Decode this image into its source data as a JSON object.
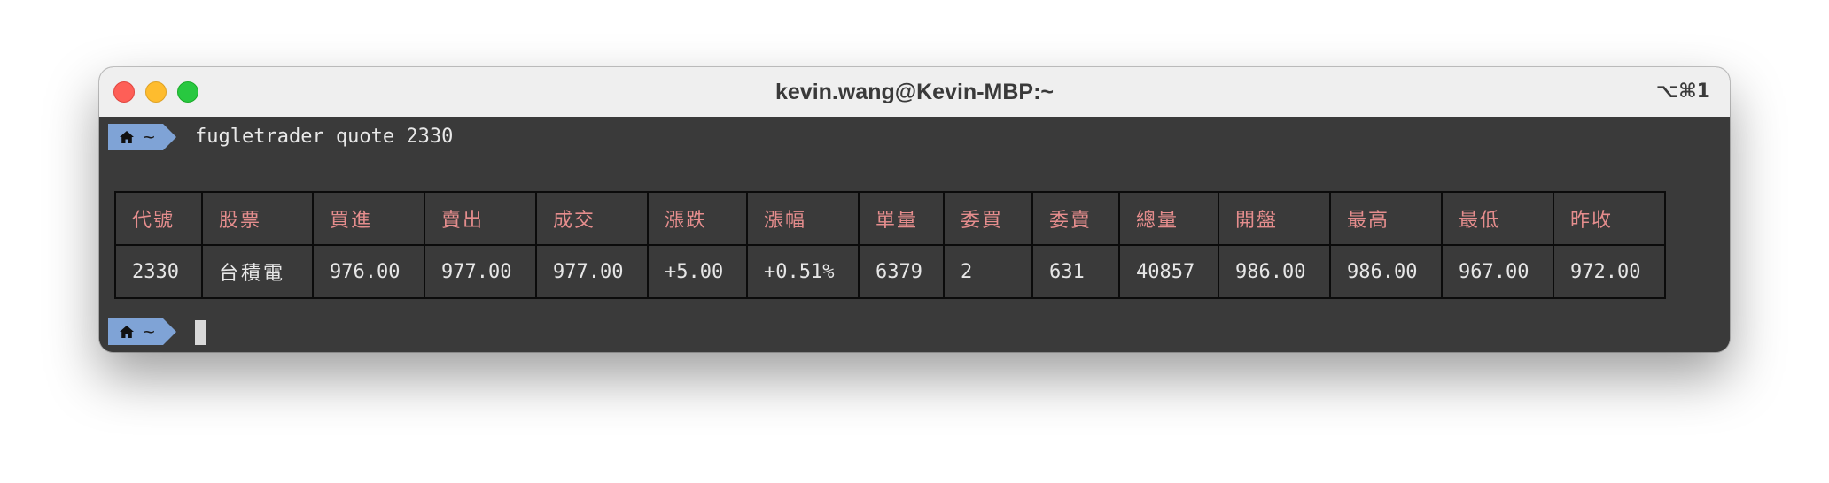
{
  "window": {
    "title": "kevin.wang@Kevin-MBP:~",
    "shortcut": "⌥⌘1"
  },
  "prompt": {
    "dir": "~",
    "command": "fugletrader quote 2330"
  },
  "quote_table": {
    "headers": [
      "代號",
      "股票",
      "買進",
      "賣出",
      "成交",
      "漲跌",
      "漲幅",
      "單量",
      "委買",
      "委賣",
      "總量",
      "開盤",
      "最高",
      "最低",
      "昨收"
    ],
    "row": [
      "2330",
      "台積電",
      "976.00",
      "977.00",
      "977.00",
      "+5.00",
      "+0.51%",
      "6379",
      "2",
      "631",
      "40857",
      "986.00",
      "986.00",
      "967.00",
      "972.00"
    ]
  },
  "colors": {
    "header_text": "#e58d8d",
    "prompt_bg": "#7fa3d6",
    "terminal_bg": "#3a3a3a"
  },
  "icons": {
    "prompt_icon": "home-icon"
  }
}
